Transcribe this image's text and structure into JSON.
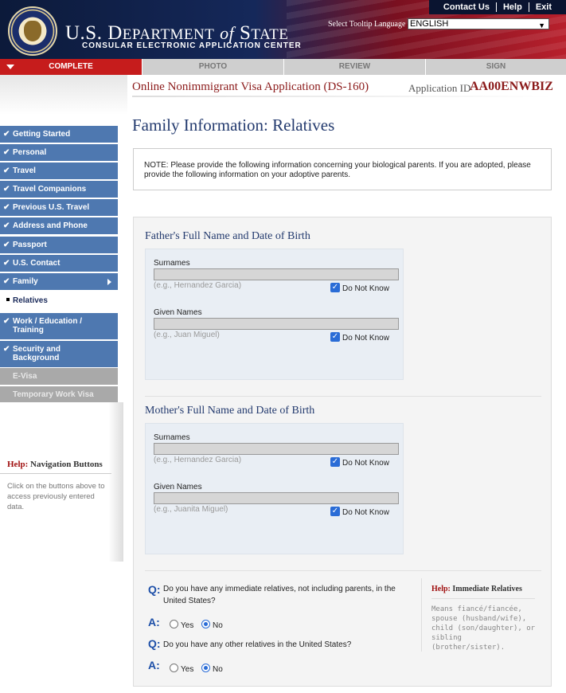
{
  "header": {
    "links": [
      "Contact Us",
      "Help",
      "Exit"
    ],
    "dept_name_1": "U.S. D",
    "dept_name_2": "EPARTMENT",
    "dept_of": "of",
    "dept_state": "S",
    "dept_state_2": "TATE",
    "subtitle": "CONSULAR ELECTRONIC APPLICATION CENTER",
    "tooltip_language_label": "Select Tooltip Language",
    "tooltip_language_value": "ENGLISH"
  },
  "progress_tabs": [
    "COMPLETE",
    "PHOTO",
    "REVIEW",
    "SIGN"
  ],
  "app": {
    "title": "Online Nonimmigrant Visa Application (DS-160)",
    "id_label": "Application ID",
    "id_value": "AA00ENWBIZ"
  },
  "sidebar": {
    "items": [
      {
        "label": "Getting Started",
        "icon": "check-icon"
      },
      {
        "label": "Personal",
        "icon": "check-icon"
      },
      {
        "label": "Travel",
        "icon": "check-icon"
      },
      {
        "label": "Travel Companions",
        "icon": "check-icon"
      },
      {
        "label": "Previous U.S. Travel",
        "icon": "check-icon"
      },
      {
        "label": "Address and Phone",
        "icon": "check-icon"
      },
      {
        "label": "Passport",
        "icon": "check-icon"
      },
      {
        "label": "U.S. Contact",
        "icon": "check-icon"
      },
      {
        "label": "Family",
        "icon": "check-icon"
      }
    ],
    "sub_item": "Relatives",
    "items_after": [
      {
        "label_1": "Work / Education /",
        "label_2": "Training"
      },
      {
        "label_1": "Security and",
        "label_2": "Background"
      }
    ],
    "disabled_items": [
      "E-Visa",
      "Temporary Work Visa"
    ],
    "help_title_prefix": "Help:",
    "help_title": "Navigation Buttons",
    "help_text": "Click on the buttons above to access previously entered data."
  },
  "main": {
    "title": "Family Information: Relatives",
    "note": "NOTE: Please provide the following information concerning your biological parents. If you are adopted, please provide the following information on your adoptive parents.",
    "father": {
      "section_title": "Father's Full Name and Date of Birth",
      "surnames_label": "Surnames",
      "surnames_hint": "(e.g., Hernandez Garcia)",
      "given_label": "Given Names",
      "given_hint": "(e.g., Juan Miguel)",
      "do_not_know": "Do Not Know"
    },
    "mother": {
      "section_title": "Mother's Full Name and Date of Birth",
      "surnames_label": "Surnames",
      "surnames_hint": "(e.g., Hernandez Garcia)",
      "given_label": "Given Names",
      "given_hint": "(e.g., Juanita Miguel)",
      "do_not_know": "Do Not Know"
    },
    "questions": [
      {
        "q": "Do you have any immediate relatives, not including parents, in the United States?",
        "yes": "Yes",
        "no": "No",
        "selected": "No"
      },
      {
        "q": "Do you have any other relatives in the United States?",
        "yes": "Yes",
        "no": "No",
        "selected": "No"
      }
    ],
    "q_marker": "Q:",
    "a_marker": "A:",
    "help": {
      "title_prefix": "Help:",
      "title": "Immediate Relatives",
      "text": "Means fiancé/fiancée, spouse (husband/wife), child (son/daughter), or sibling (brother/sister)."
    }
  },
  "colors": {
    "nav_blue": "#4e78b0",
    "accent_red": "#c61c1c",
    "title_navy": "#233a6e"
  }
}
